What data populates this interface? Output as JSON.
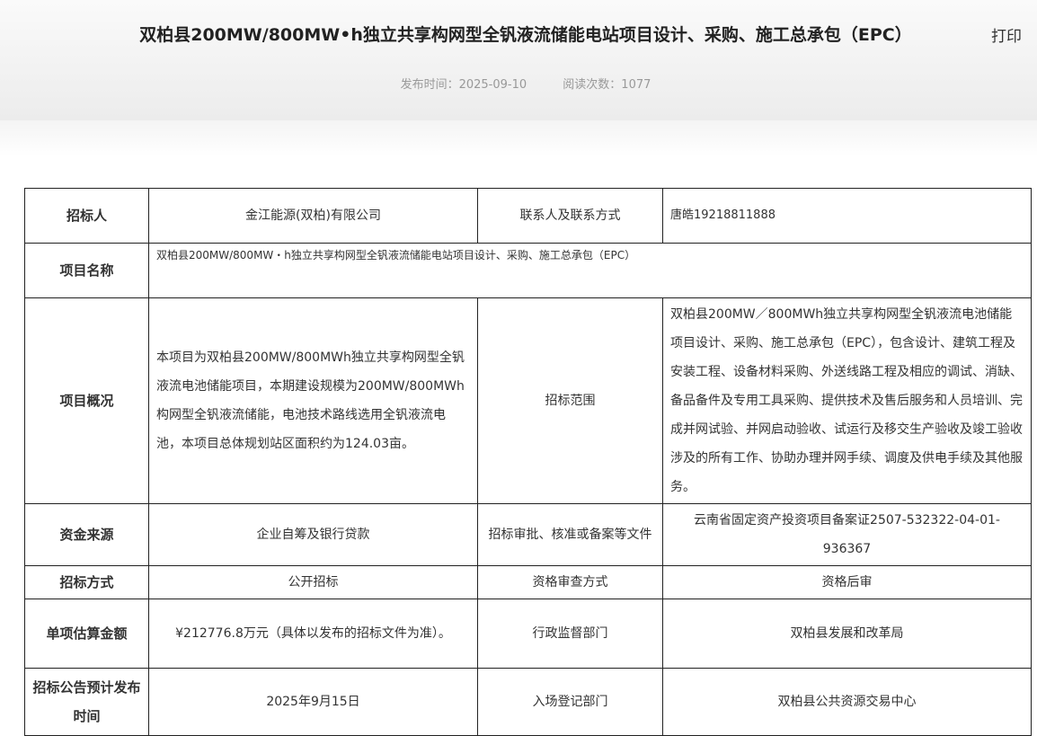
{
  "header": {
    "title": "双柏县200MW/800MW•h独立共享构网型全钒液流储能电站项目设计、采购、施工总承包（EPC）",
    "print": "打印",
    "publish_time": "发布时间：2025-09-10",
    "read_count": "阅读次数：1077"
  },
  "table": {
    "r1": {
      "l1": "招标人",
      "v1": "金江能源(双柏)有限公司",
      "l2": "联系人及联系方式",
      "v2": "唐皓19218811888"
    },
    "r2": {
      "l1": "项目名称",
      "v1": "双柏县200MW/800MW・h独立共享构网型全钒液流储能电站项目设计、采购、施工总承包（EPC）"
    },
    "r3": {
      "l1": "项目概况",
      "v1": "本项目为双柏县200MW/800MWh独立共享构网型全钒液流电池储能项目，本期建设规模为200MW/800MWh构网型全钒液流储能，电池技术路线选用全钒液流电池，本项目总体规划站区面积约为124.03亩。",
      "l2": "招标范围",
      "v2": "双柏县200MW／800MWh独立共享构网型全钒液流电池储能项目设计、采购、施工总承包（EPC），包含设计、建筑工程及安装工程、设备材料采购、外送线路工程及相应的调试、消缺、备品备件及专用工具采购、提供技术及售后服务和人员培训、完成并网试验、并网启动验收、试运行及移交生产验收及竣工验收涉及的所有工作、协助办理并网手续、调度及供电手续及其他服务。"
    },
    "r4": {
      "l1": "资金来源",
      "v1": "企业自筹及银行贷款",
      "l2": "招标审批、核准或备案等文件",
      "v2": "云南省固定资产投资项目备案证2507-532322-04-01-936367"
    },
    "r5": {
      "l1": "招标方式",
      "v1": "公开招标",
      "l2": "资格审查方式",
      "v2": "资格后审"
    },
    "r6": {
      "l1": "单项估算金额",
      "v1": "¥212776.8万元（具体以发布的招标文件为准）。",
      "l2": "行政监督部门",
      "v2": "双柏县发展和改革局"
    },
    "r7": {
      "l1": "招标公告预计发布时间",
      "v1": "2025年9月15日",
      "l2": "入场登记部门",
      "v2": "双柏县公共资源交易中心"
    }
  }
}
